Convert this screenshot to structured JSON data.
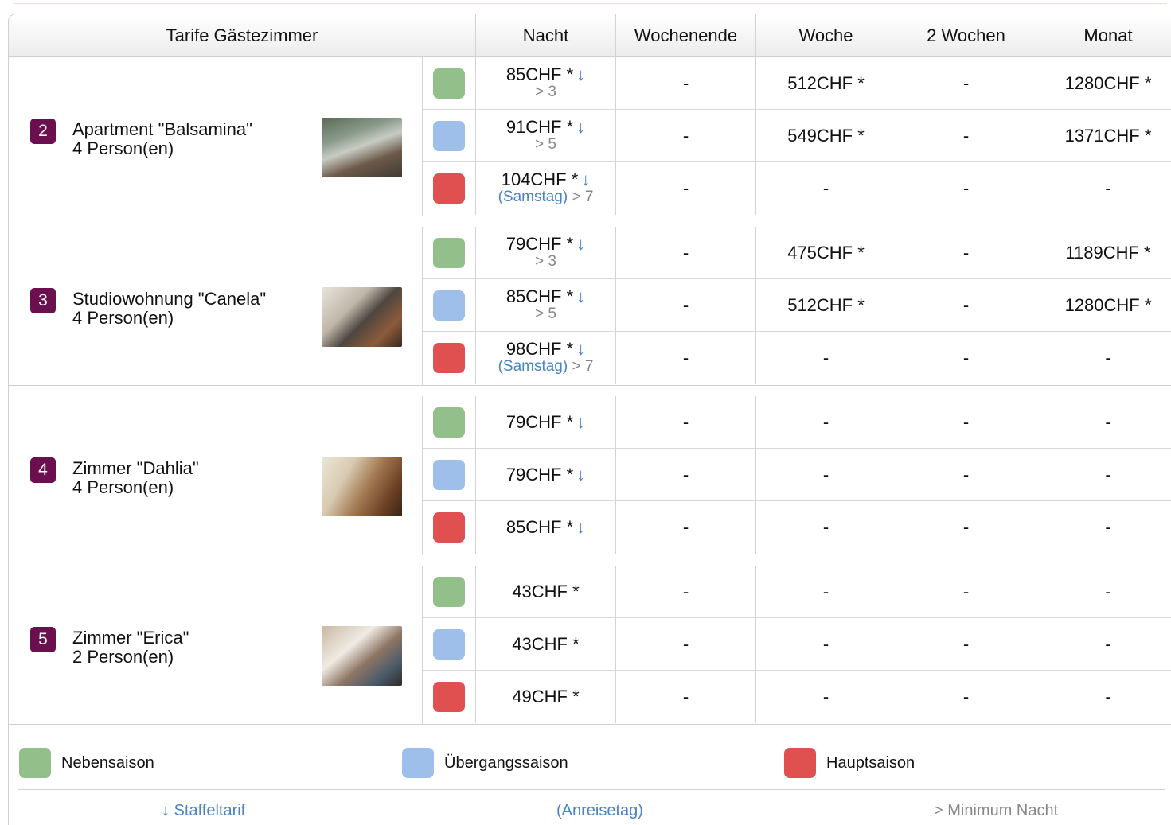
{
  "header": {
    "room_col": "Tarife Gästezimmer",
    "columns": [
      "Nacht",
      "Wochenende",
      "Woche",
      "2 Wochen",
      "Monat"
    ]
  },
  "colors": {
    "green": "#93c08a",
    "blue": "#9dbfea",
    "red": "#e05050",
    "badge": "#6b0f4e",
    "link": "#4a84c4"
  },
  "icons": {
    "arrow": "↓"
  },
  "rooms": [
    {
      "number": "2",
      "name": "Apartment \"Balsamina\"",
      "persons": "4 Person(en)",
      "rows": [
        {
          "price": "85CHF *",
          "arrow": "↓",
          "sub_link": "",
          "sub": "> 3",
          "weekend": "-",
          "week": "512CHF *",
          "two_weeks": "-",
          "month": "1280CHF *"
        },
        {
          "price": "91CHF *",
          "arrow": "↓",
          "sub_link": "",
          "sub": "> 5",
          "weekend": "-",
          "week": "549CHF *",
          "two_weeks": "-",
          "month": "1371CHF *"
        },
        {
          "price": "104CHF *",
          "arrow": "↓",
          "sub_link": "(Samstag)",
          "sub": " > 7",
          "weekend": "-",
          "week": "-",
          "two_weeks": "-",
          "month": "-"
        }
      ]
    },
    {
      "number": "3",
      "name": "Studiowohnung \"Canela\"",
      "persons": "4 Person(en)",
      "rows": [
        {
          "price": "79CHF *",
          "arrow": "↓",
          "sub_link": "",
          "sub": "> 3",
          "weekend": "-",
          "week": "475CHF *",
          "two_weeks": "-",
          "month": "1189CHF *"
        },
        {
          "price": "85CHF *",
          "arrow": "↓",
          "sub_link": "",
          "sub": "> 5",
          "weekend": "-",
          "week": "512CHF *",
          "two_weeks": "-",
          "month": "1280CHF *"
        },
        {
          "price": "98CHF *",
          "arrow": "↓",
          "sub_link": "(Samstag)",
          "sub": " > 7",
          "weekend": "-",
          "week": "-",
          "two_weeks": "-",
          "month": "-"
        }
      ]
    },
    {
      "number": "4",
      "name": "Zimmer \"Dahlia\"",
      "persons": "4 Person(en)",
      "rows": [
        {
          "price": "79CHF *",
          "arrow": "↓",
          "sub_link": "",
          "sub": "",
          "weekend": "-",
          "week": "-",
          "two_weeks": "-",
          "month": "-"
        },
        {
          "price": "79CHF *",
          "arrow": "↓",
          "sub_link": "",
          "sub": "",
          "weekend": "-",
          "week": "-",
          "two_weeks": "-",
          "month": "-"
        },
        {
          "price": "85CHF *",
          "arrow": "↓",
          "sub_link": "",
          "sub": "",
          "weekend": "-",
          "week": "-",
          "two_weeks": "-",
          "month": "-"
        }
      ]
    },
    {
      "number": "5",
      "name": "Zimmer \"Erica\"",
      "persons": "2 Person(en)",
      "rows": [
        {
          "price": "43CHF *",
          "arrow": "",
          "sub_link": "",
          "sub": "",
          "weekend": "-",
          "week": "-",
          "two_weeks": "-",
          "month": "-"
        },
        {
          "price": "43CHF *",
          "arrow": "",
          "sub_link": "",
          "sub": "",
          "weekend": "-",
          "week": "-",
          "two_weeks": "-",
          "month": "-"
        },
        {
          "price": "49CHF *",
          "arrow": "",
          "sub_link": "",
          "sub": "",
          "weekend": "-",
          "week": "-",
          "two_weeks": "-",
          "month": "-"
        }
      ]
    }
  ],
  "legend": {
    "seasons": [
      "Nebensaison",
      "Übergangssaison",
      "Hauptsaison"
    ],
    "footer": [
      "↓ Staffeltarif",
      "(Anreisetag)",
      "> Minimum Nacht"
    ]
  }
}
